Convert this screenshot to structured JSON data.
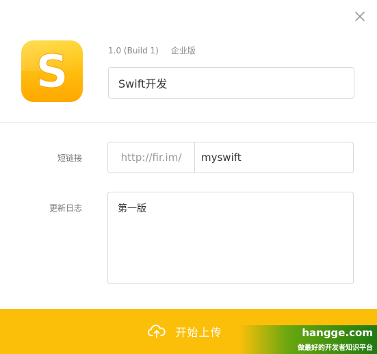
{
  "app": {
    "icon_letter": "S",
    "version": "1.0 (Build 1)",
    "edition": "企业版",
    "name": "Swift开发"
  },
  "icons": {
    "close": "close-icon",
    "upload": "cloud-upload-icon"
  },
  "form": {
    "short_link": {
      "label": "短链接",
      "prefix": "http://fir.im/",
      "value": "myswift"
    },
    "changelog": {
      "label": "更新日志",
      "value": "第一版"
    }
  },
  "upload": {
    "label": "开始上传"
  },
  "watermark": {
    "site": "hangge.com",
    "slogan": "做最好的开发者知识平台"
  },
  "colors": {
    "accent": "#fbbf0a",
    "icon_gradient_top": "#ffd21e",
    "icon_gradient_bottom": "#ffa800"
  }
}
